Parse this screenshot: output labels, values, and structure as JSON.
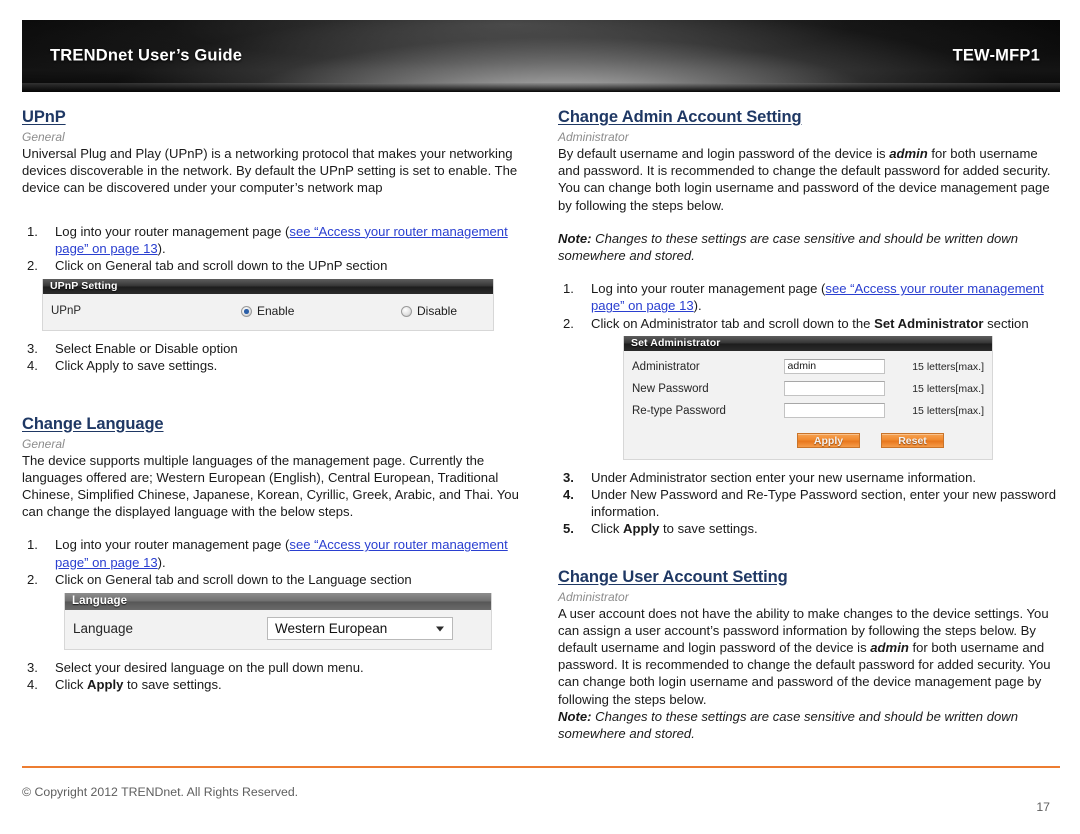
{
  "header": {
    "title": "TRENDnet User’s Guide",
    "model": "TEW-MFP1"
  },
  "left_column": {
    "upnp": {
      "title": "UPnP",
      "subtitle": "General",
      "paragraph": "Universal Plug and Play (UPnP) is a networking protocol that makes your networking devices discoverable in the network. By default the UPnP setting is set to enable. The device can be discovered under your computer’s network map",
      "steps_before": [
        {
          "text_before": "Log into your router management page (",
          "link": "see “Access your router management page” on page 13",
          "text_after": ")."
        },
        {
          "text_before": "Click on General tab and scroll down to the UPnP section",
          "link": "",
          "text_after": ""
        }
      ],
      "widget": {
        "header": "UPnP Setting",
        "row_label": "UPnP",
        "option_enable": "Enable",
        "option_disable": "Disable",
        "selected": "Enable"
      },
      "steps_after": [
        "Select Enable or Disable option",
        "Click Apply to save settings."
      ],
      "steps_after_start": 3
    },
    "language": {
      "title": "Change Language",
      "subtitle": "General",
      "paragraph": "The device supports multiple languages of the management page. Currently the languages offered are; Western European (English), Central European, Traditional Chinese, Simplified Chinese, Japanese, Korean, Cyrillic, Greek, Arabic, and Thai. You can change the displayed language with the below steps.",
      "steps_before": [
        {
          "text_before": "Log into your router management page (",
          "link": "see “Access your router management page” on page 13",
          "text_after": ")."
        },
        {
          "text_before": "Click on General tab and scroll down to the Language section",
          "link": "",
          "text_after": ""
        }
      ],
      "widget": {
        "header": "Language",
        "row_label": "Language",
        "selected": "Western European",
        "options": [
          "Western European",
          "Central European",
          "Traditional Chinese",
          "Simplified Chinese",
          "Japanese",
          "Korean",
          "Cyrillic",
          "Greek",
          "Arabic",
          "Thai"
        ]
      },
      "step3_text": "Select your desired language on the pull down menu.",
      "step4_pre": "Click ",
      "step4_bold": "Apply",
      "step4_post": " to save settings.",
      "steps_after_start": 3
    }
  },
  "right_column": {
    "admin_account": {
      "title": "Change Admin Account Setting",
      "subtitle": "Administrator",
      "para_1": "By default username and login password of the device is ",
      "para_1_bold": "admin",
      "para_1_rest": " for both username and password. It is recommended to change the default password for added security. You can change both login username and password of the device management page by following the steps below.",
      "note_label": "Note:",
      "note_text": " Changes to these settings are case sensitive and should be written down somewhere and stored.",
      "steps_before": [
        {
          "text_before": "Log into your router management page (",
          "link": "see “Access your router management page” on page 13",
          "text_after": ")."
        },
        {
          "text_before": "Click on Administrator tab and scroll down to the ",
          "bold": "Set Administrator",
          "text_after": " section"
        }
      ],
      "widget": {
        "header": "Set Administrator",
        "rows": [
          {
            "label": "Administrator",
            "value": "admin",
            "placeholder": "",
            "hint": "15 letters[max.]"
          },
          {
            "label": "New Password",
            "value": "",
            "placeholder": "",
            "hint": "15 letters[max.]"
          },
          {
            "label": "Re-type Password",
            "value": "",
            "placeholder": "",
            "hint": "15 letters[max.]"
          }
        ],
        "apply_label": "Apply",
        "reset_label": "Reset"
      },
      "steps_after": [
        {
          "pre": "Under Administrator section enter your new username information.",
          "bold": "",
          "post": ""
        },
        {
          "pre": "Under New Password and Re-Type Password section, enter your new password information.",
          "bold": "",
          "post": ""
        },
        {
          "pre": "Click ",
          "bold": "Apply",
          "post": " to save settings."
        }
      ],
      "steps_after_start": 3
    },
    "user_account": {
      "title": "Change User Account Setting",
      "subtitle": "Administrator",
      "para_pre": "A user account does not have the ability to make changes to the device settings. You can assign a user account’s password information by following the steps below. By default username and login password of the device is ",
      "para_bold": "admin",
      "para_post": " for both username and password. It is recommended to change the default password for added security. You can change both login username and password of the device management page by following the steps below.",
      "note_label": "Note:",
      "note_text": " Changes to these settings are case sensitive and should be written down somewhere and stored."
    }
  },
  "footer": {
    "copyright": "© Copyright 2012 TRENDnet. All Rights Reserved.",
    "page_number": "17"
  },
  "colors": {
    "accent_orange": "#ed7d31",
    "heading_blue": "#1f3864",
    "link_blue": "#2a3fd0",
    "subtitle_gray": "#8c8c8c"
  }
}
